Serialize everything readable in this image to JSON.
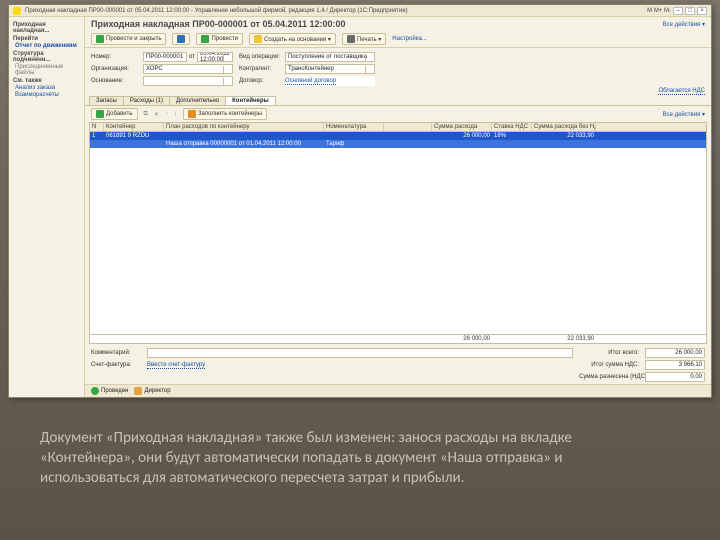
{
  "window": {
    "title": "Приходная накладная ПР00-000001 от 05.04.2011 12:00:00 - Управление небольшой фирмой, редакция 1.4 / Директор (1С:Предприятие)",
    "win_min": "–",
    "win_max": "□",
    "win_close": "×",
    "win_m": "M",
    "win_mplus": "M+",
    "win_mminus": "M-"
  },
  "nav": {
    "breadcrumb": "Приходная накладная...",
    "sections": [
      {
        "type": "section",
        "label": "Перейти"
      },
      {
        "type": "link",
        "label": "Отчет по движениям",
        "bold": true
      },
      {
        "type": "section",
        "label": "Структура подчиненн..."
      },
      {
        "type": "link",
        "label": "Присоединенные файлы",
        "dim": true
      },
      {
        "type": "section",
        "label": "См. также"
      },
      {
        "type": "link",
        "label": "Анализ заказа"
      },
      {
        "type": "link",
        "label": "Взаиморасчеты"
      }
    ]
  },
  "doc": {
    "title": "Приходная накладная ПР00-000001 от 05.04.2011 12:00:00",
    "all_actions": "Все действия ▾"
  },
  "toolbar": {
    "post_and_close": "Провести и закрыть",
    "post": "Провести",
    "create_based": "Создать на основании ▾",
    "print": "Печать ▾",
    "docflow": "Настройка..."
  },
  "form": {
    "labels": {
      "number": "Номер:",
      "date_prefix": "от",
      "org": "Организация:",
      "basis": "Основание:",
      "op_type": "Вид операции:",
      "contragent": "Контрагент:",
      "contract": "Договор:"
    },
    "values": {
      "number": "ПР00-000001",
      "date": "05.04.2011 12:00:00",
      "org": "ХОРС",
      "basis": "",
      "op_type": "Поступление от поставщика",
      "contragent": "ТрансКонтейнер",
      "contract": "Основной договор"
    },
    "vat_label": "Облагается НДС",
    "vat_link": ""
  },
  "tabs": {
    "items": [
      "Запасы",
      "Расходы (1)",
      "Дополнительно",
      "Контейнеры"
    ],
    "active": 3
  },
  "subbar": {
    "add": "Добавить",
    "copy_ico": "⧉",
    "del_ico": "✕",
    "up_ico": "↑",
    "dn_ico": "↓",
    "fill": "Заполнить контейнеры",
    "all_actions": "Все действия ▾"
  },
  "grid": {
    "cols": [
      "N",
      "Контейнер",
      "План расходов по контейнеру",
      "Номенклатура",
      "",
      "Сумма расхода",
      "Ставка НДС",
      "Сумма расхода без НДС"
    ],
    "master": [
      "1",
      "061891 9 RZDU",
      "",
      "",
      "",
      "26 000,00",
      "18%",
      "22 033,90"
    ],
    "detail": [
      "",
      "",
      "Наша отправка 00000001 от 01.04.2011 12:00:00",
      "Тариф",
      "",
      "",
      "",
      ""
    ],
    "totals_sum": "26 000,00",
    "totals_nett": "22 033,90"
  },
  "bottom": {
    "comment_lbl": "Комментарий:",
    "comment_val": "",
    "row1_lbl": "Итог всего:",
    "row1_val": "26 000,00",
    "row2_lbl": "Итог сумма НДС:",
    "row2_val": "3 966,10",
    "row3_lbl": "Сумма разнесена (НДС):",
    "row3_val": "0,00",
    "sf_lbl": "Счет-фактура:",
    "sf_link": "Ввести счет-фактуру"
  },
  "status": {
    "posted": "Проведен",
    "user": "Директор"
  },
  "caption": "Документ «Приходная накладная» также был изменен: занося расходы на вкладке «Контейнера», они будут автоматически попадать в документ «Наша отправка» и использоваться для автоматического пересчета затрат и прибыли."
}
